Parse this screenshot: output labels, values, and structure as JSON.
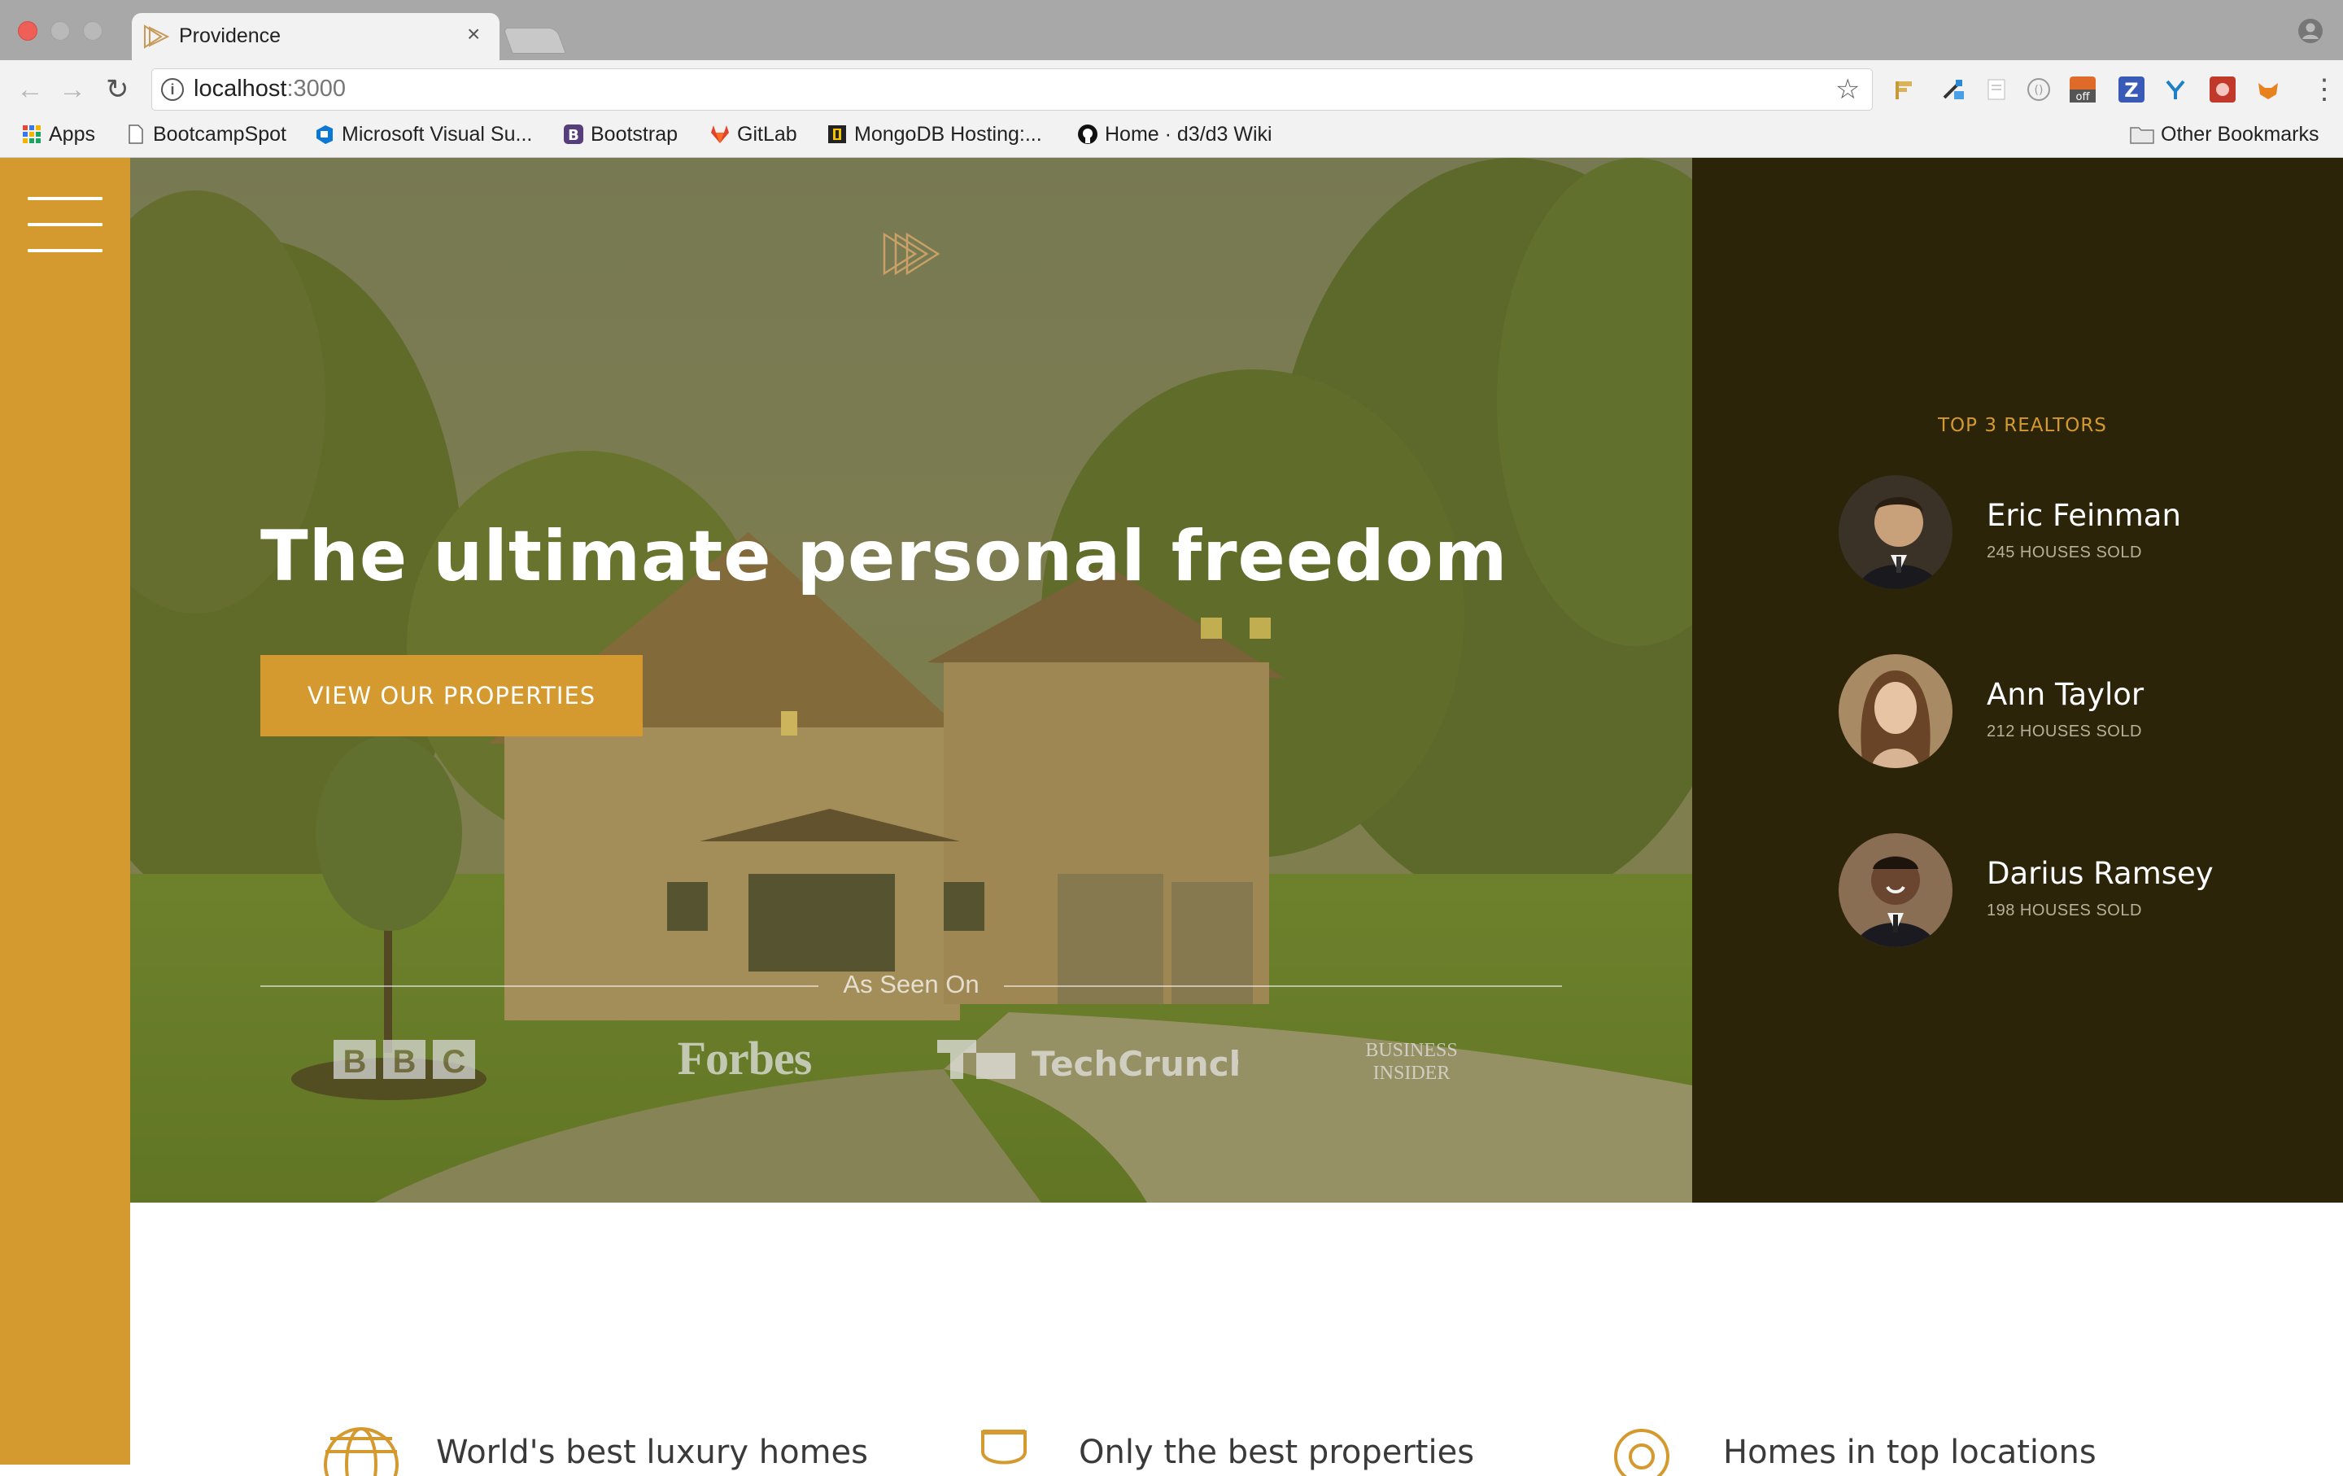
{
  "browser": {
    "tab_title": "Providence",
    "tab_close": "×",
    "url_host": "localhost",
    "url_port": ":3000",
    "bookmarks": [
      {
        "label": "Apps",
        "icon": "apps-grid-icon"
      },
      {
        "label": "BootcampSpot",
        "icon": "page-icon"
      },
      {
        "label": "Microsoft Visual Su...",
        "icon": "azure-devops-icon"
      },
      {
        "label": "Bootstrap",
        "icon": "bootstrap-icon"
      },
      {
        "label": "GitLab",
        "icon": "gitlab-icon"
      },
      {
        "label": "MongoDB Hosting:...",
        "icon": "mlab-icon"
      },
      {
        "label": "Home · d3/d3 Wiki",
        "icon": "github-icon"
      }
    ],
    "other_bookmarks": "Other Bookmarks",
    "extension_off_badge": "off"
  },
  "hero": {
    "title": "The ultimate personal freedom",
    "cta_label": "VIEW OUR PROPERTIES",
    "as_seen_on": "As Seen On",
    "press": {
      "bbc": [
        "B",
        "B",
        "C"
      ],
      "forbes": "Forbes",
      "techcrunch": "TechCrunch",
      "business_insider": [
        "BUSINESS",
        "INSIDER"
      ]
    }
  },
  "realtors": {
    "heading": "TOP 3 REALTORS",
    "items": [
      {
        "name": "Eric Feinman",
        "sold": "245 HOUSES SOLD"
      },
      {
        "name": "Ann Taylor",
        "sold": "212 HOUSES SOLD"
      },
      {
        "name": "Darius Ramsey",
        "sold": "198 HOUSES SOLD"
      }
    ]
  },
  "features": [
    {
      "text": "World's best luxury homes",
      "icon": "globe-icon"
    },
    {
      "text": "Only the best properties",
      "icon": "trophy-icon"
    },
    {
      "text": "Homes in top locations",
      "icon": "map-pin-icon"
    }
  ],
  "colors": {
    "accent": "#d4992f",
    "panel": "#2c2409",
    "chrome": "#a8a8a8"
  }
}
